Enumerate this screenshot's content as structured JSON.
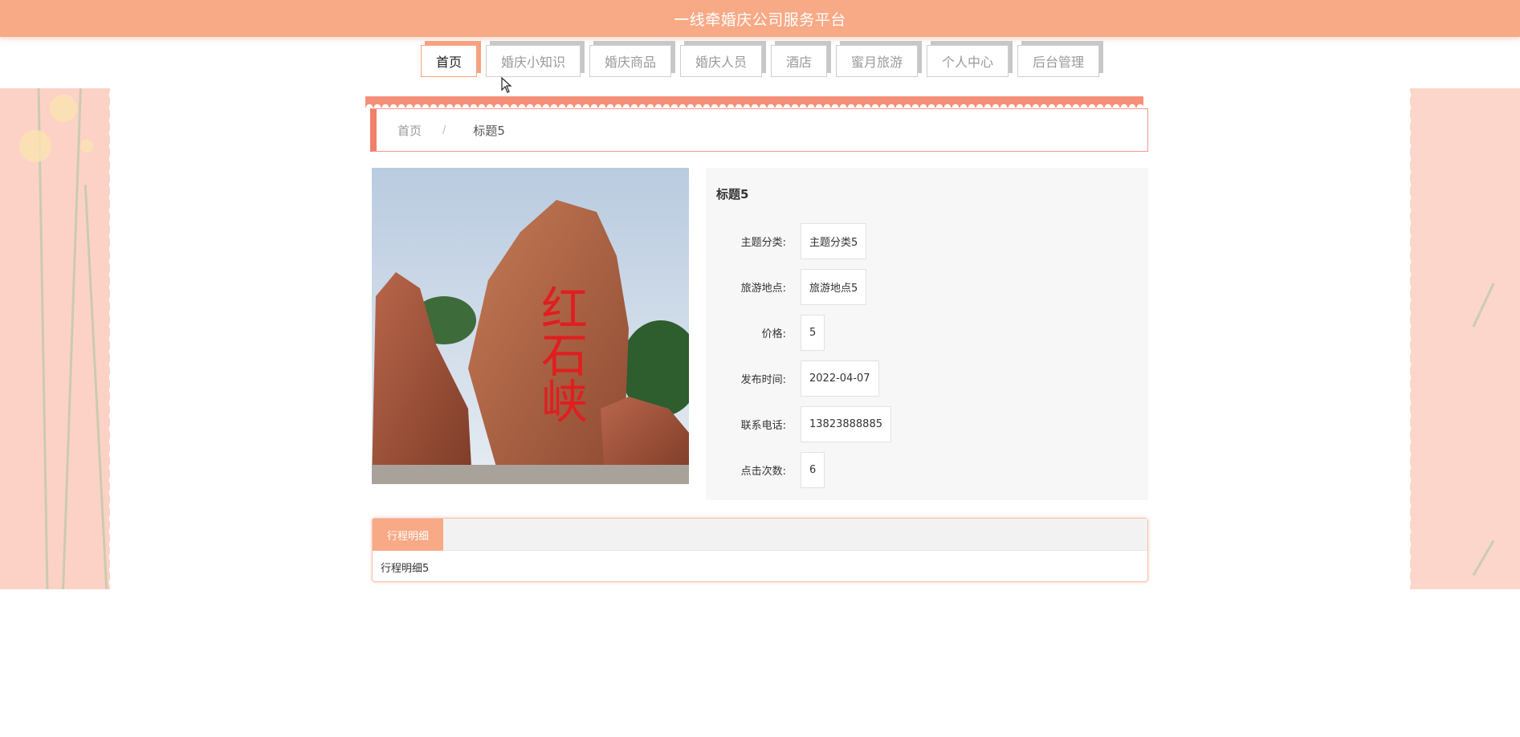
{
  "header": {
    "title": "一线牵婚庆公司服务平台"
  },
  "nav": {
    "items": [
      {
        "label": "首页",
        "active": true
      },
      {
        "label": "婚庆小知识",
        "active": false
      },
      {
        "label": "婚庆商品",
        "active": false
      },
      {
        "label": "婚庆人员",
        "active": false
      },
      {
        "label": "酒店",
        "active": false
      },
      {
        "label": "蜜月旅游",
        "active": false
      },
      {
        "label": "个人中心",
        "active": false
      },
      {
        "label": "后台管理",
        "active": false
      }
    ]
  },
  "breadcrumb": {
    "home": "首页",
    "separator": "/",
    "current": "标题5"
  },
  "detail": {
    "title": "标题5",
    "fields": [
      {
        "label": "主题分类:",
        "value": "主题分类5"
      },
      {
        "label": "旅游地点:",
        "value": "旅游地点5"
      },
      {
        "label": "价格:",
        "value": "5"
      },
      {
        "label": "发布时间:",
        "value": "2022-04-07"
      },
      {
        "label": "联系电话:",
        "value": "13823888885"
      },
      {
        "label": "点击次数:",
        "value": "6"
      }
    ],
    "image_text": "红石峡"
  },
  "tabs": {
    "active_label": "行程明细",
    "content": "行程明细5"
  },
  "colors": {
    "accent": "#f8a985",
    "accent_dark": "#f0806a",
    "panel_bg": "#f7f7f7",
    "side_deco": "#fcd2c7"
  }
}
